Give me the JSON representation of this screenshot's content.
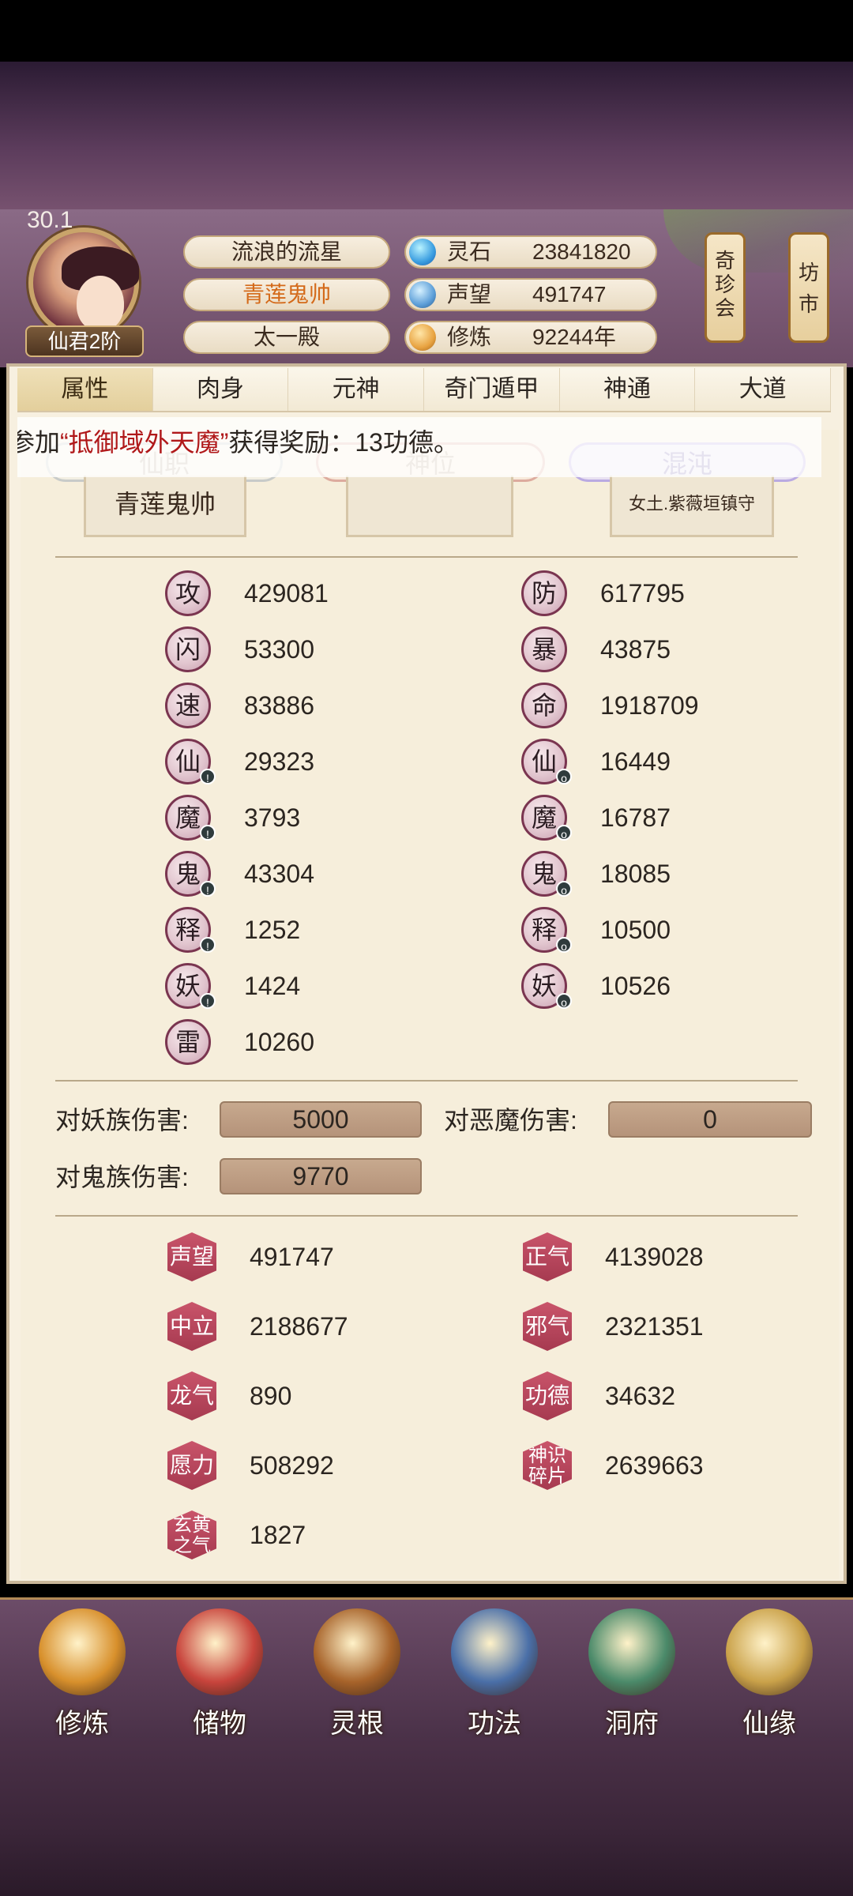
{
  "fps": "30.1",
  "player": {
    "rank": "仙君2阶",
    "name": "流浪的流星",
    "title": "青莲鬼帅",
    "location": "太一殿"
  },
  "resources": [
    {
      "label": "灵石",
      "value": "23841820",
      "icon": "spirit-stone-icon"
    },
    {
      "label": "声望",
      "value": "491747",
      "icon": "reputation-icon"
    },
    {
      "label": "修炼",
      "value": "92244年",
      "icon": "cultivation-icon"
    }
  ],
  "side_buttons": [
    {
      "label": "奇\n珍\n会"
    },
    {
      "label": "坊\n市"
    }
  ],
  "tabs": [
    {
      "label": "属性",
      "active": true
    },
    {
      "label": "肉身"
    },
    {
      "label": "元神"
    },
    {
      "label": "奇门遁甲"
    },
    {
      "label": "神通"
    },
    {
      "label": "大道"
    }
  ],
  "notice": {
    "prefix": "参加",
    "quote_open": "“",
    "highlight": "抵御域外天魔",
    "quote_close": "”",
    "suffix": "获得奖励：13功德。"
  },
  "banners": {
    "left_title": "仙职",
    "mid_title": "神位",
    "right_title": "混沌",
    "left_value": "青莲鬼帅",
    "mid_value": "",
    "right_value": "女土.紫薇垣镇守"
  },
  "stats_left": [
    {
      "icon": "攻",
      "value": "429081"
    },
    {
      "icon": "闪",
      "value": "53300"
    },
    {
      "icon": "速",
      "value": "83886"
    },
    {
      "icon": "仙",
      "value": "29323",
      "badge": "!"
    },
    {
      "icon": "魔",
      "value": "3793",
      "badge": "!"
    },
    {
      "icon": "鬼",
      "value": "43304",
      "badge": "!"
    },
    {
      "icon": "释",
      "value": "1252",
      "badge": "!"
    },
    {
      "icon": "妖",
      "value": "1424",
      "badge": "!"
    },
    {
      "icon": "雷",
      "value": "10260"
    }
  ],
  "stats_right": [
    {
      "icon": "防",
      "value": "617795"
    },
    {
      "icon": "暴",
      "value": "43875"
    },
    {
      "icon": "命",
      "value": "1918709"
    },
    {
      "icon": "仙",
      "value": "16449",
      "badge": "o"
    },
    {
      "icon": "魔",
      "value": "16787",
      "badge": "o"
    },
    {
      "icon": "鬼",
      "value": "18085",
      "badge": "o"
    },
    {
      "icon": "释",
      "value": "10500",
      "badge": "o"
    },
    {
      "icon": "妖",
      "value": "10526",
      "badge": "o"
    }
  ],
  "damage": {
    "yao_label": "对妖族伤害:",
    "yao_value": "5000",
    "emo_label": "对恶魔伤害:",
    "emo_value": "0",
    "gui_label": "对鬼族伤害:",
    "gui_value": "9770"
  },
  "reputation_left": [
    {
      "icon": "声望",
      "value": "491747"
    },
    {
      "icon": "中立",
      "value": "2188677"
    },
    {
      "icon": "龙气",
      "value": "890"
    },
    {
      "icon": "愿力",
      "value": "508292"
    },
    {
      "icon": "玄黄之气",
      "value": "1827"
    }
  ],
  "reputation_right": [
    {
      "icon": "正气",
      "value": "4139028"
    },
    {
      "icon": "邪气",
      "value": "2321351"
    },
    {
      "icon": "功德",
      "value": "34632"
    },
    {
      "icon": "神识碎片",
      "value": "2639663"
    }
  ],
  "bottom_nav": [
    {
      "label": "修炼",
      "color": "#d8902c"
    },
    {
      "label": "储物",
      "color": "#c8443c"
    },
    {
      "label": "灵根",
      "color": "#a7632a"
    },
    {
      "label": "功法",
      "color": "#4a6fa8"
    },
    {
      "label": "洞府",
      "color": "#4b8a6a"
    },
    {
      "label": "仙缘",
      "color": "#caa24a"
    }
  ]
}
